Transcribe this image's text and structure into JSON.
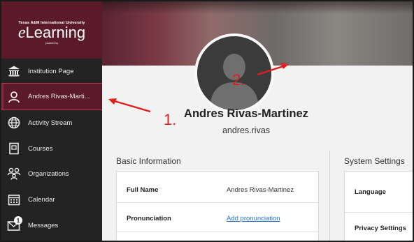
{
  "sidebar": {
    "logo": {
      "university": "Texas A&M International University",
      "brand_e": "e",
      "brand_rest": "Learning",
      "powered": "powered by"
    },
    "items": [
      {
        "label": "Institution Page",
        "icon": "bank-icon"
      },
      {
        "label": "Andres Rivas-Marti...",
        "icon": "person-icon",
        "active": true
      },
      {
        "label": "Activity Stream",
        "icon": "globe-icon"
      },
      {
        "label": "Courses",
        "icon": "course-icon"
      },
      {
        "label": "Organizations",
        "icon": "organizations-icon"
      },
      {
        "label": "Calendar",
        "icon": "calendar-icon"
      },
      {
        "label": "Messages",
        "icon": "messages-icon",
        "badge": "1"
      }
    ]
  },
  "profile": {
    "name": "Andres Rivas-Martinez",
    "username": "andres.rivas"
  },
  "basic_info": {
    "title": "Basic Information",
    "rows": [
      {
        "key": "Full Name",
        "value": "Andres Rivas-Martinez"
      },
      {
        "key": "Pronunciation",
        "value": "Add pronunciation"
      }
    ]
  },
  "system_settings": {
    "title": "System Settings",
    "rows": [
      {
        "key": "Language"
      },
      {
        "key": "Privacy Settings"
      }
    ]
  },
  "annotations": {
    "one": "1.",
    "two": "2."
  },
  "colors": {
    "sidebar_bg": "#232323",
    "brand": "#5b1a27",
    "arrow": "#e01e1e",
    "link": "#2a72c3"
  }
}
